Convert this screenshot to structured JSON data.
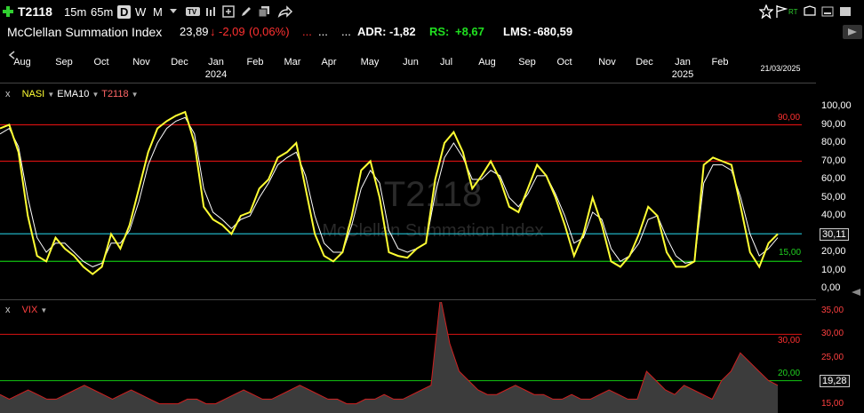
{
  "toolbar": {
    "plus_icon": "plus-icon",
    "symbol": "T2118",
    "timeframes": [
      "15m",
      "65m",
      "D",
      "W",
      "M"
    ],
    "active_timeframe": "D"
  },
  "header": {
    "indicator_name": "McClellan Summation Index",
    "last_value": "23,89",
    "change": "-2,09",
    "change_pct": "(0,06%)",
    "dots_red": "...",
    "dots_white": "...",
    "adr_label": "ADR:",
    "adr_value": "-1,82",
    "rs_label": "RS:",
    "rs_value": "+8,67",
    "lms_label": "LMS:",
    "lms_value": "-680,59"
  },
  "months": {
    "labels": [
      "Aug",
      "Sep",
      "Oct",
      "Nov",
      "Dec",
      "Jan",
      "Feb",
      "Mar",
      "Apr",
      "May",
      "Jun",
      "Jul",
      "Aug",
      "Sep",
      "Oct",
      "Nov",
      "Dec",
      "Jan",
      "Feb"
    ],
    "year_2024": "2024",
    "year_2025": "2025",
    "date": "21/03/2025"
  },
  "main_panel": {
    "legend": [
      "NASI",
      "EMA10",
      "T2118"
    ],
    "watermark_symbol": "T2118",
    "watermark_name": "McClellan Summation Index",
    "y_ticks": [
      "100,00",
      "90,00",
      "80,00",
      "70,00",
      "60,00",
      "50,00",
      "40,00",
      "30,00",
      "20,00",
      "10,00",
      "0,00"
    ],
    "level_90": "90,00",
    "level_15": "15,00",
    "current_value": "30,11",
    "colors": {
      "nasi": "#ffff33",
      "ema": "#ffffff",
      "red_line": "#d01010",
      "green_line": "#10c010",
      "cyan_line": "#20b0c0"
    }
  },
  "vix_panel": {
    "legend": "VIX",
    "level_30": "30,00",
    "level_20": "20,00",
    "y_ticks": [
      "35,00",
      "30,00",
      "25,00",
      "20,00",
      "15,00"
    ],
    "current_value": "19,28",
    "colors": {
      "fill": "#3a3a3a",
      "line": "#ff3030"
    }
  },
  "chart_data": [
    {
      "type": "line",
      "title": "",
      "series": [
        {
          "name": "NASI",
          "values": [
            88,
            90,
            75,
            40,
            18,
            15,
            28,
            22,
            18,
            12,
            8,
            12,
            30,
            22,
            35,
            55,
            75,
            88,
            92,
            95,
            97,
            80,
            45,
            38,
            35,
            30,
            40,
            42,
            55,
            60,
            72,
            75,
            80,
            55,
            30,
            18,
            15,
            20,
            40,
            65,
            70,
            50,
            20,
            18,
            17,
            22,
            25,
            60,
            80,
            86,
            75,
            55,
            62,
            70,
            60,
            45,
            42,
            55,
            68,
            62,
            50,
            35,
            18,
            30,
            50,
            35,
            15,
            12,
            18,
            30,
            45,
            40,
            20,
            12,
            12,
            15,
            68,
            72,
            70,
            68,
            45,
            20,
            12,
            25,
            30
          ]
        },
        {
          "name": "EMA10",
          "values": [
            85,
            88,
            78,
            50,
            28,
            20,
            25,
            25,
            20,
            15,
            12,
            14,
            25,
            25,
            32,
            48,
            68,
            80,
            88,
            92,
            94,
            85,
            55,
            42,
            38,
            33,
            38,
            40,
            50,
            58,
            68,
            72,
            75,
            62,
            40,
            25,
            20,
            20,
            35,
            55,
            65,
            58,
            32,
            22,
            20,
            22,
            25,
            52,
            72,
            80,
            72,
            60,
            60,
            65,
            62,
            50,
            45,
            52,
            62,
            62,
            52,
            40,
            25,
            28,
            42,
            38,
            22,
            15,
            18,
            25,
            38,
            40,
            28,
            18,
            14,
            15,
            58,
            68,
            68,
            65,
            50,
            30,
            18,
            22,
            28
          ]
        }
      ],
      "ylim": [
        0,
        100
      ],
      "hlines": [
        90,
        70,
        30.11,
        15
      ]
    },
    {
      "type": "area",
      "title": "",
      "series": [
        {
          "name": "VIX",
          "values": [
            17,
            16,
            17,
            18,
            17,
            16,
            16,
            17,
            18,
            19,
            18,
            17,
            16,
            17,
            18,
            17,
            16,
            15,
            15,
            15,
            16,
            16,
            15,
            15,
            16,
            17,
            18,
            17,
            16,
            16,
            17,
            18,
            19,
            18,
            17,
            16,
            16,
            15,
            15,
            16,
            16,
            17,
            16,
            16,
            17,
            18,
            19,
            38,
            28,
            22,
            20,
            18,
            17,
            17,
            18,
            19,
            18,
            17,
            17,
            16,
            16,
            17,
            16,
            16,
            17,
            18,
            17,
            16,
            16,
            22,
            20,
            18,
            17,
            19,
            18,
            17,
            16,
            20,
            22,
            26,
            24,
            22,
            20,
            19
          ]
        }
      ],
      "ylim": [
        13,
        37
      ],
      "hlines": [
        30,
        20
      ]
    }
  ]
}
